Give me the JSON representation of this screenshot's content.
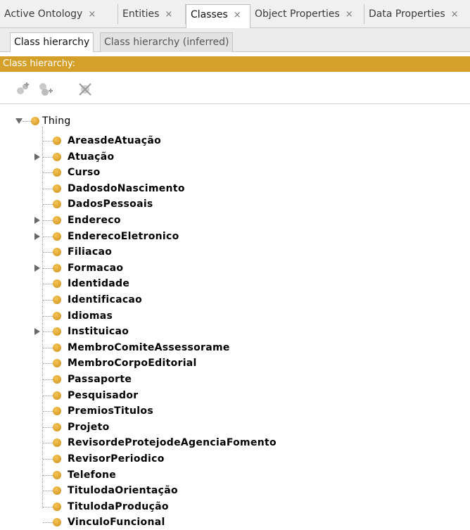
{
  "tabs": [
    {
      "label": "Active Ontology",
      "close": "×",
      "selected": false
    },
    {
      "label": "Entities",
      "close": "×",
      "selected": false
    },
    {
      "label": "Classes",
      "close": "×",
      "selected": true
    },
    {
      "label": "Object Properties",
      "close": "×",
      "selected": false
    },
    {
      "label": "Data Properties",
      "close": "×",
      "selected": false
    }
  ],
  "subtabs": [
    {
      "label": "Class hierarchy",
      "selected": true
    },
    {
      "label": "Class hierarchy (inferred)",
      "selected": false
    }
  ],
  "header": {
    "title": "Class hierarchy:"
  },
  "toolbar": {
    "tools": [
      {
        "icon": "add-subclass-icon"
      },
      {
        "icon": "add-sibling-class-icon"
      },
      {
        "icon": "delete-class-icon"
      }
    ]
  },
  "colors": {
    "accent": "#d5a02a",
    "class_bullet": "#e0a732"
  },
  "tree": {
    "root": {
      "label": "Thing",
      "expanded": true
    },
    "children": [
      {
        "label": "AreasdeAtuação",
        "has_children": false
      },
      {
        "label": "Atuação",
        "has_children": true
      },
      {
        "label": "Curso",
        "has_children": false
      },
      {
        "label": "DadosdoNascimento",
        "has_children": false
      },
      {
        "label": "DadosPessoais",
        "has_children": false
      },
      {
        "label": "Endereco",
        "has_children": true
      },
      {
        "label": "EnderecoEletronico",
        "has_children": true
      },
      {
        "label": "Filiacao",
        "has_children": false
      },
      {
        "label": "Formacao",
        "has_children": true
      },
      {
        "label": "Identidade",
        "has_children": false
      },
      {
        "label": "Identificacao",
        "has_children": false
      },
      {
        "label": "Idiomas",
        "has_children": false
      },
      {
        "label": "Instituicao",
        "has_children": true
      },
      {
        "label": "MembroComiteAssessorame",
        "has_children": false
      },
      {
        "label": "MembroCorpoEditorial",
        "has_children": false
      },
      {
        "label": "Passaporte",
        "has_children": false
      },
      {
        "label": "Pesquisador",
        "has_children": false
      },
      {
        "label": "PremiosTitulos",
        "has_children": false
      },
      {
        "label": "Projeto",
        "has_children": false
      },
      {
        "label": "RevisordeProtejodeAgenciaFomento",
        "has_children": false
      },
      {
        "label": "RevisorPeriodico",
        "has_children": false
      },
      {
        "label": "Telefone",
        "has_children": false
      },
      {
        "label": "TitulodaOrientação",
        "has_children": false
      },
      {
        "label": "TitulodaProdução",
        "has_children": false
      },
      {
        "label": "VinculoFuncional",
        "has_children": false
      }
    ]
  }
}
